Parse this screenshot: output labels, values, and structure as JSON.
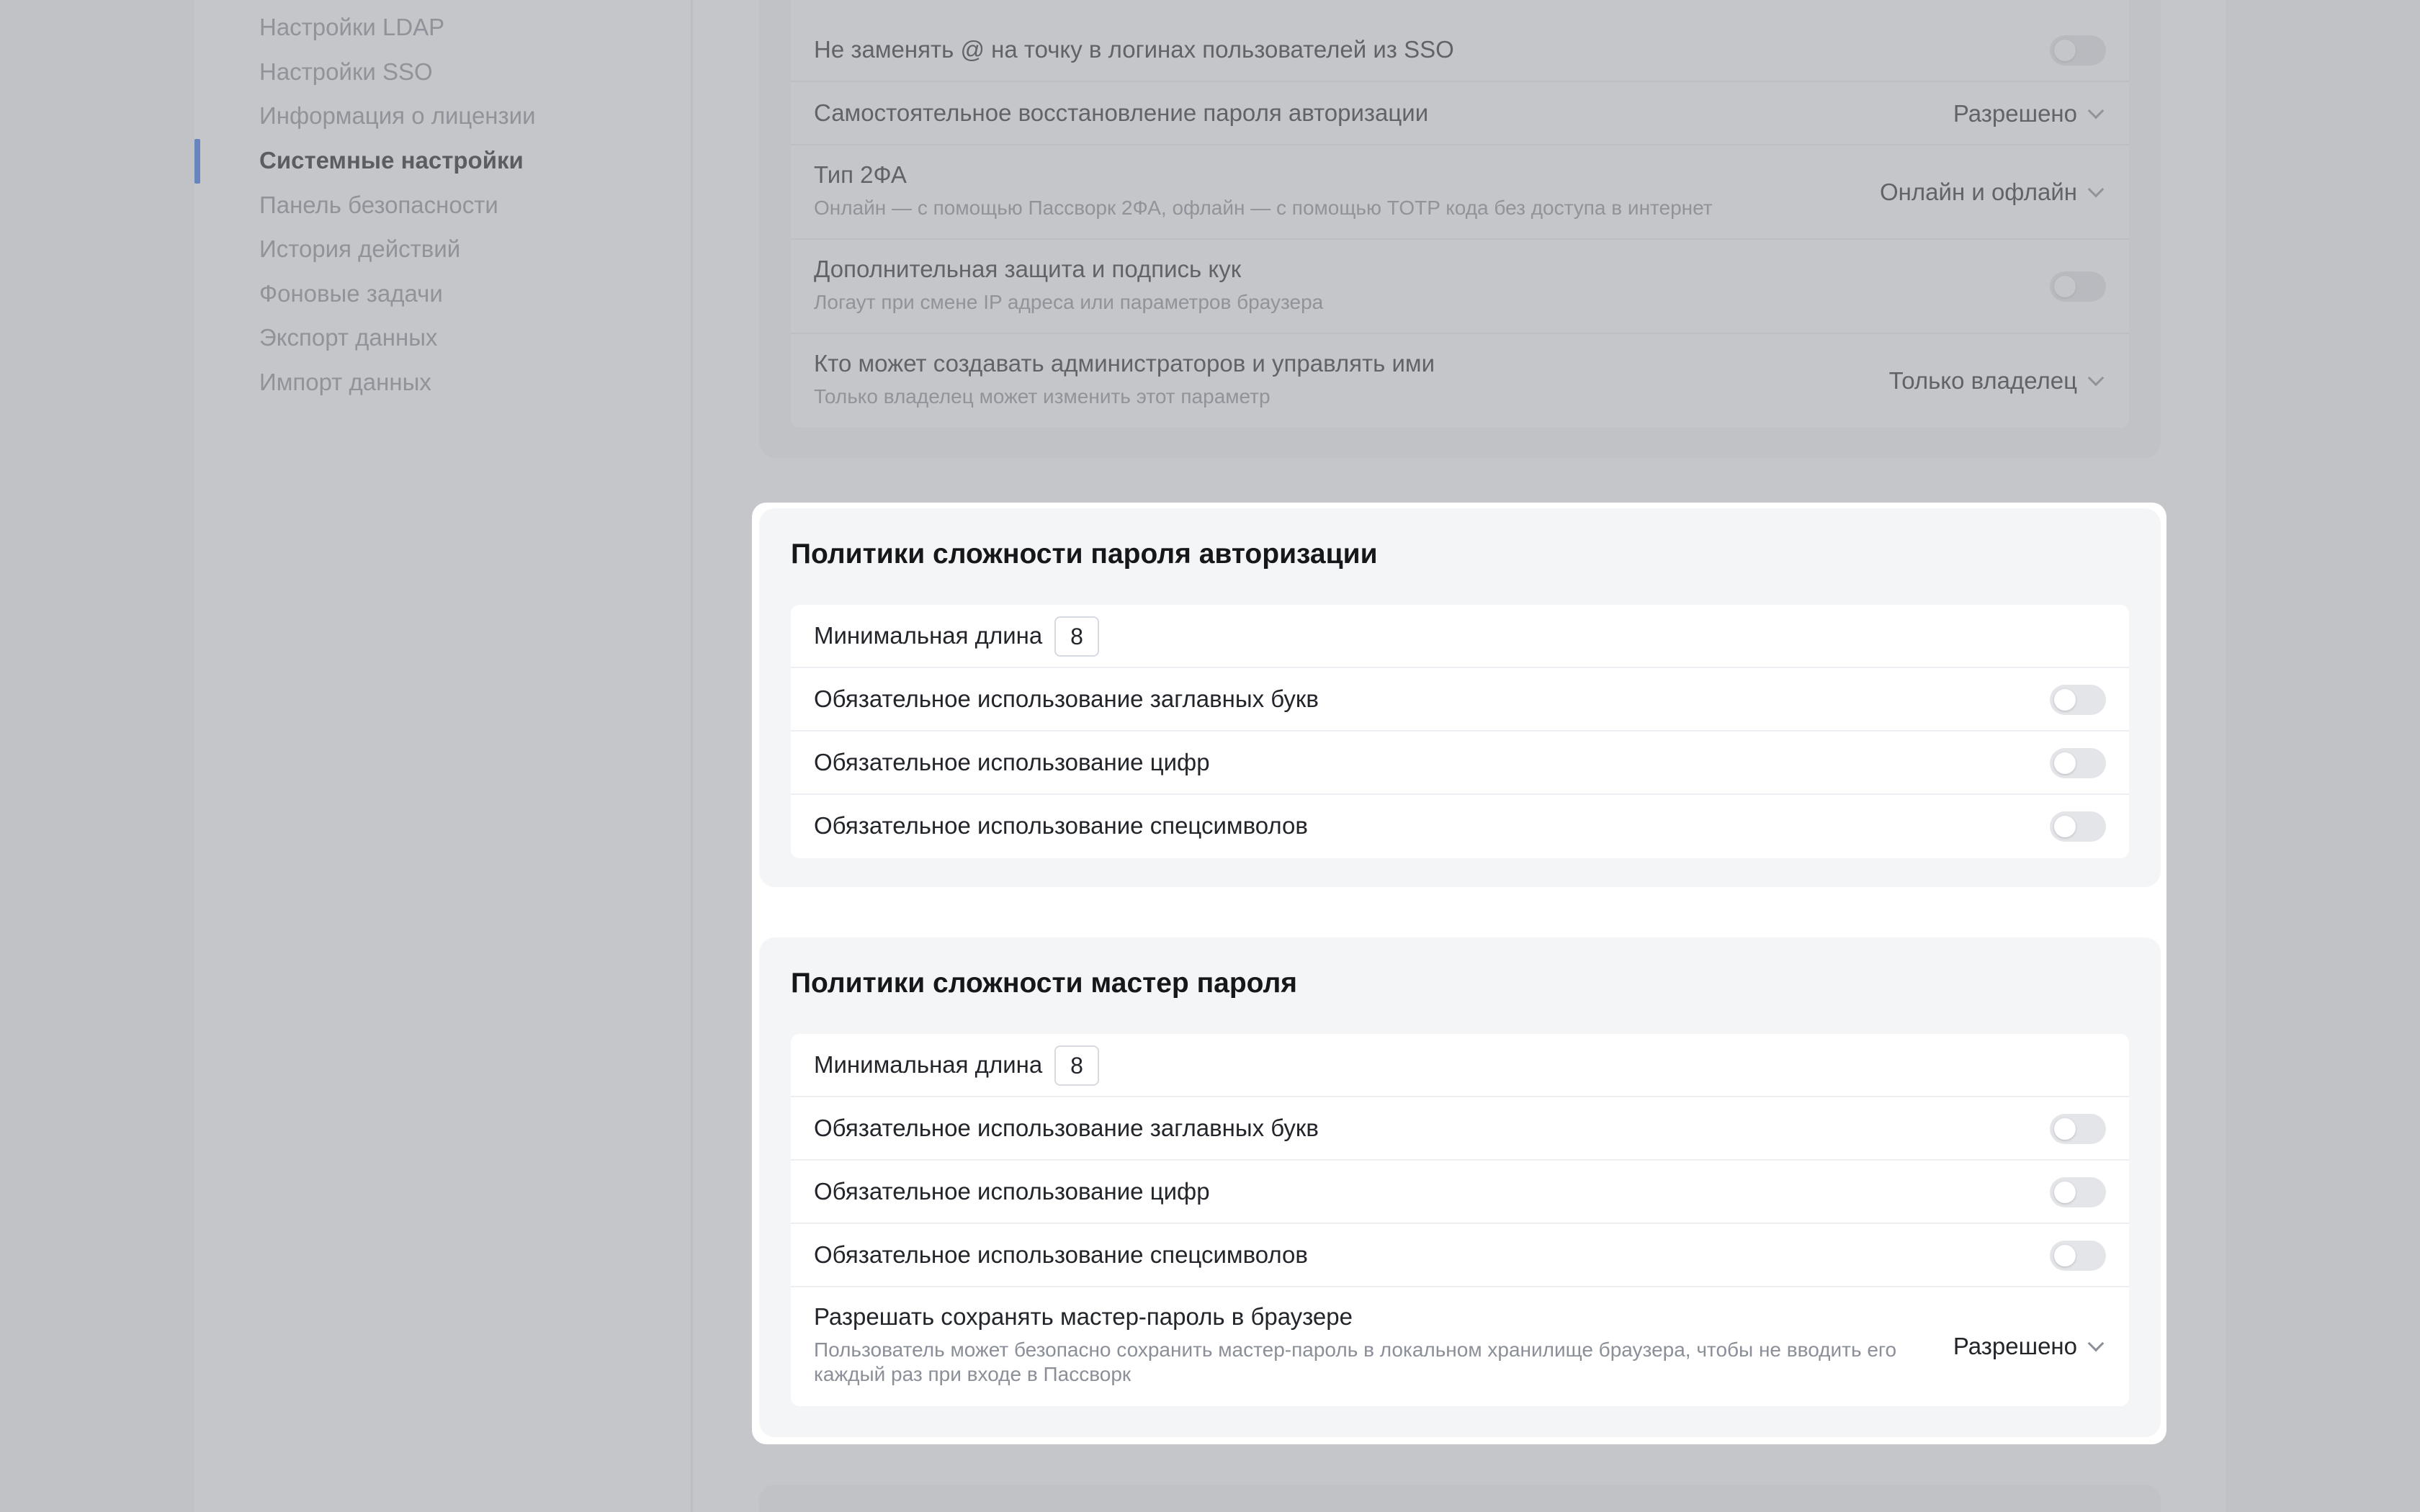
{
  "sidebar": {
    "items": [
      {
        "label": "Настройки LDAP"
      },
      {
        "label": "Настройки SSO"
      },
      {
        "label": "Информация о лицензии"
      },
      {
        "label": "Системные настройки",
        "active": true
      },
      {
        "label": "Панель безопасности"
      },
      {
        "label": "История действий"
      },
      {
        "label": "Фоновые задачи"
      },
      {
        "label": "Экспорт данных"
      },
      {
        "label": "Импорт данных"
      }
    ]
  },
  "system": {
    "rows": [
      {
        "label": "Не заменять @ на точку в логинах пользователей из SSO"
      },
      {
        "label": "Самостоятельное восстановление пароля авторизации",
        "value": "Разрешено"
      },
      {
        "label": "Тип 2ФА",
        "sub": "Онлайн — с помощью Пассворк 2ФА, офлайн — с помощью TOTP кода без доступа в интернет",
        "value": "Онлайн и офлайн"
      },
      {
        "label": "Дополнительная защита и подпись кук",
        "sub": "Логаут при смене IP адреса или параметров браузера"
      },
      {
        "label": "Кто может создавать администраторов и управлять ими",
        "sub": "Только владелец может изменить этот параметр",
        "value": "Только владелец"
      }
    ]
  },
  "auth_policy": {
    "title": "Политики сложности пароля авторизации",
    "min_length_label": "Минимальная длина",
    "min_length": "8",
    "uppercase_label": "Обязательное использование заглавных букв",
    "digits_label": "Обязательное использование цифр",
    "special_label": "Обязательное использование спецсимволов"
  },
  "master_policy": {
    "title": "Политики сложности мастер пароля",
    "min_length_label": "Минимальная длина",
    "min_length": "8",
    "uppercase_label": "Обязательное использование заглавных букв",
    "digits_label": "Обязательное использование цифр",
    "special_label": "Обязательное использование спецсимволов",
    "save_label": "Разрешать сохранять мастер-пароль в браузере",
    "save_sub": "Пользователь может безопасно сохранить мастер-пароль в локальном хранилище браузера, чтобы не вводить его каждый раз при входе в Пассворк",
    "save_value": "Разрешено"
  },
  "colors": {
    "accent": "#2f6fe6",
    "overlay": "#96989c"
  }
}
